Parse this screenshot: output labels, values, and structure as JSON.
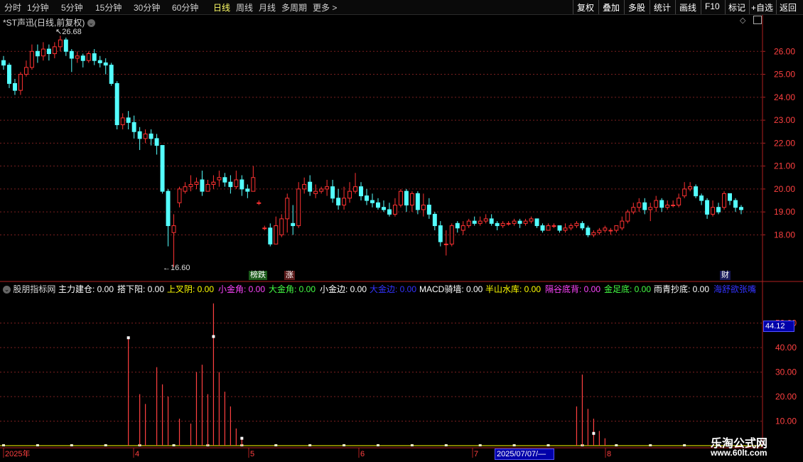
{
  "toolbar": {
    "tabs": [
      "分时",
      "1分钟",
      "5分钟",
      "15分钟",
      "30分钟",
      "60分钟",
      "日线",
      "周线",
      "月线",
      "多周期",
      "更多 >"
    ],
    "active_tab": "日线",
    "tools": [
      "复权",
      "叠加",
      "多股",
      "统计",
      "画线",
      "F10",
      "标记",
      "+自选",
      "返回"
    ]
  },
  "main_chart": {
    "title": "*ST声迅(日线,前复权)",
    "high_label": "26.68",
    "low_label": "16.60",
    "badges": [
      "榜跌",
      "涨",
      "财"
    ]
  },
  "indicator": {
    "title": "股朋指标网",
    "items": [
      {
        "label": "主力建仓: 0.00",
        "color": "#ffffff"
      },
      {
        "label": "搭下阳: 0.00",
        "color": "#ffffff"
      },
      {
        "label": "上叉阴: 0.00",
        "color": "#ffff00"
      },
      {
        "label": "小金角: 0.00",
        "color": "#ff44ff"
      },
      {
        "label": "大金角: 0.00",
        "color": "#44ff44"
      },
      {
        "label": "小金边: 0.00",
        "color": "#ffffff"
      },
      {
        "label": "大金边: 0.00",
        "color": "#3333ff"
      },
      {
        "label": "MACD骑墙: 0.00",
        "color": "#ffffff"
      },
      {
        "label": "半山水库: 0.00",
        "color": "#ffff00"
      },
      {
        "label": "隔谷底背: 0.00",
        "color": "#ff44ff"
      },
      {
        "label": "金足底: 0.00",
        "color": "#44ff44"
      },
      {
        "label": "雨青抄底: 0.00",
        "color": "#ffffff"
      },
      {
        "label": "海舒欲张嘴",
        "color": "#3333ff"
      }
    ],
    "level_value": "44.12"
  },
  "axes": {
    "price_ticks": [
      "26.00",
      "25.00",
      "24.00",
      "23.00",
      "22.00",
      "21.00",
      "20.00",
      "19.00",
      "18.00"
    ],
    "indicator_ticks": [
      "50.00",
      "40.00",
      "30.00",
      "20.00",
      "10.00"
    ],
    "date_labels": [
      "2025年",
      "4",
      "5",
      "6",
      "7",
      "8"
    ],
    "cursor_date": "2025/07/07/—"
  },
  "watermark": {
    "line1": "乐淘公式网",
    "line2": "www.60lt.com"
  },
  "colors": {
    "up": "#ff3232",
    "down": "#54ffff",
    "grid": "#7a1f1f",
    "axis": "#b02020"
  },
  "chart_data": {
    "type": "candlestick",
    "price_range": [
      16.0,
      27.0
    ],
    "candles": [
      [
        25.6,
        25.4,
        25.8,
        25.2
      ],
      [
        25.4,
        24.6,
        25.5,
        24.4
      ],
      [
        24.6,
        24.3,
        24.8,
        24.1
      ],
      [
        24.3,
        25.0,
        25.1,
        24.1
      ],
      [
        25.0,
        25.3,
        25.6,
        24.9
      ],
      [
        25.3,
        26.0,
        26.3,
        25.2
      ],
      [
        26.0,
        25.8,
        26.3,
        25.5
      ],
      [
        25.8,
        26.1,
        26.4,
        25.6
      ],
      [
        26.1,
        25.9,
        26.3,
        25.6
      ],
      [
        25.9,
        26.2,
        26.4,
        25.7
      ],
      [
        26.2,
        26.5,
        26.68,
        26.0
      ],
      [
        26.5,
        26.0,
        26.6,
        25.8
      ],
      [
        26.0,
        25.7,
        26.1,
        25.1
      ],
      [
        25.7,
        25.8,
        26.0,
        25.5
      ],
      [
        25.8,
        25.6,
        25.9,
        25.3
      ],
      [
        25.6,
        25.9,
        26.0,
        25.5
      ],
      [
        25.9,
        25.6,
        26.1,
        25.4
      ],
      [
        25.6,
        25.5,
        25.8,
        25.3
      ],
      [
        25.5,
        25.4,
        25.7,
        25.0
      ],
      [
        25.4,
        24.6,
        25.5,
        24.5
      ],
      [
        24.6,
        22.8,
        24.7,
        22.6
      ],
      [
        22.8,
        23.1,
        23.3,
        22.6
      ],
      [
        23.1,
        22.9,
        23.4,
        22.6
      ],
      [
        22.9,
        22.5,
        23.2,
        22.2
      ],
      [
        22.5,
        22.2,
        22.7,
        21.7
      ],
      [
        22.2,
        22.4,
        22.6,
        22.0
      ],
      [
        22.4,
        22.2,
        22.6,
        21.9
      ],
      [
        22.2,
        21.9,
        22.4,
        21.5
      ],
      [
        21.9,
        19.9,
        21.9,
        19.8
      ],
      [
        19.9,
        18.4,
        20.0,
        17.5
      ],
      [
        18.1,
        18.4,
        18.9,
        16.6
      ],
      [
        19.4,
        20.0,
        20.1,
        19.2
      ],
      [
        19.9,
        20.1,
        20.3,
        19.8
      ],
      [
        20.1,
        20.2,
        20.6,
        19.9
      ],
      [
        20.2,
        20.3,
        20.5,
        20.0
      ],
      [
        20.4,
        19.9,
        20.8,
        19.7
      ],
      [
        19.9,
        20.2,
        20.4,
        19.9
      ],
      [
        20.2,
        20.3,
        20.6,
        20.0
      ],
      [
        20.4,
        20.5,
        20.8,
        20.1
      ],
      [
        20.5,
        20.3,
        20.7,
        20.1
      ],
      [
        20.3,
        20.1,
        20.6,
        19.8
      ],
      [
        20.1,
        20.4,
        20.8,
        20.0
      ],
      [
        20.4,
        20.0,
        20.6,
        19.7
      ],
      [
        20.0,
        19.9,
        20.2,
        19.6
      ],
      [
        19.9,
        20.5,
        21.0,
        19.9
      ],
      [
        19.4,
        19.4,
        19.5,
        19.3
      ],
      [
        18.3,
        18.3,
        18.4,
        18.2
      ],
      [
        18.3,
        17.6,
        18.5,
        17.5
      ],
      [
        17.6,
        18.4,
        18.8,
        17.6
      ],
      [
        18.0,
        18.7,
        18.9,
        17.9
      ],
      [
        18.7,
        19.6,
        19.8,
        18.1
      ],
      [
        18.5,
        18.4,
        19.3,
        18.0
      ],
      [
        18.4,
        20.0,
        20.3,
        18.3
      ],
      [
        20.0,
        20.2,
        20.5,
        19.8
      ],
      [
        20.3,
        19.9,
        20.6,
        19.7
      ],
      [
        19.8,
        19.9,
        20.2,
        19.6
      ],
      [
        19.9,
        20.0,
        20.1,
        19.8
      ],
      [
        20.0,
        20.1,
        20.4,
        19.7
      ],
      [
        20.1,
        19.6,
        20.4,
        19.4
      ],
      [
        19.6,
        19.3,
        20.0,
        19.1
      ],
      [
        19.3,
        19.6,
        20.1,
        19.1
      ],
      [
        19.6,
        19.9,
        20.3,
        19.4
      ],
      [
        19.9,
        20.1,
        20.7,
        19.8
      ],
      [
        20.1,
        19.7,
        20.3,
        19.5
      ],
      [
        19.7,
        19.5,
        20.0,
        19.3
      ],
      [
        19.5,
        19.4,
        19.8,
        19.2
      ],
      [
        19.4,
        19.2,
        19.6,
        19.1
      ],
      [
        19.2,
        19.1,
        19.5,
        19.0
      ],
      [
        19.1,
        18.9,
        19.4,
        18.8
      ],
      [
        18.9,
        19.3,
        19.6,
        18.8
      ],
      [
        19.3,
        19.9,
        20.0,
        19.2
      ],
      [
        19.9,
        19.3,
        20.0,
        19.0
      ],
      [
        19.3,
        19.8,
        19.9,
        19.0
      ],
      [
        19.8,
        19.1,
        19.9,
        18.9
      ],
      [
        19.1,
        19.3,
        19.8,
        18.8
      ],
      [
        19.3,
        18.9,
        19.6,
        18.7
      ],
      [
        18.9,
        18.4,
        19.0,
        18.2
      ],
      [
        18.4,
        17.7,
        18.6,
        17.5
      ],
      [
        17.6,
        17.6,
        18.2,
        17.1
      ],
      [
        17.6,
        18.4,
        18.5,
        17.5
      ],
      [
        18.5,
        18.3,
        18.6,
        18.1
      ],
      [
        18.2,
        18.4,
        18.6,
        18.0
      ],
      [
        18.4,
        18.6,
        18.7,
        18.3
      ],
      [
        18.6,
        18.5,
        18.8,
        18.4
      ],
      [
        18.5,
        18.6,
        18.8,
        18.4
      ],
      [
        18.6,
        18.7,
        18.9,
        18.5
      ],
      [
        18.7,
        18.5,
        18.9,
        18.4
      ],
      [
        18.5,
        18.4,
        18.6,
        18.2
      ],
      [
        18.4,
        18.5,
        18.6,
        18.3
      ],
      [
        18.5,
        18.5,
        18.6,
        18.4
      ],
      [
        18.5,
        18.6,
        18.7,
        18.4
      ],
      [
        18.6,
        18.5,
        18.7,
        18.3
      ],
      [
        18.5,
        18.6,
        18.7,
        18.4
      ],
      [
        18.6,
        18.7,
        18.8,
        18.5
      ],
      [
        18.7,
        18.4,
        18.7,
        18.3
      ],
      [
        18.4,
        18.2,
        18.5,
        18.1
      ],
      [
        18.2,
        18.4,
        18.5,
        18.2
      ],
      [
        18.4,
        18.4,
        18.5,
        18.3
      ],
      [
        18.4,
        18.2,
        18.4,
        18.1
      ],
      [
        18.2,
        18.3,
        18.5,
        18.1
      ],
      [
        18.3,
        18.4,
        18.5,
        18.2
      ],
      [
        18.4,
        18.5,
        18.6,
        18.3
      ],
      [
        18.5,
        18.3,
        18.6,
        18.2
      ],
      [
        18.3,
        18.0,
        18.4,
        17.9
      ],
      [
        18.0,
        18.1,
        18.2,
        17.9
      ],
      [
        18.1,
        18.2,
        18.3,
        18.0
      ],
      [
        18.2,
        18.3,
        18.4,
        18.1
      ],
      [
        18.2,
        18.2,
        18.3,
        18.0
      ],
      [
        18.2,
        18.4,
        18.4,
        18.1
      ],
      [
        18.3,
        18.6,
        18.8,
        18.2
      ],
      [
        18.6,
        19.0,
        19.1,
        18.5
      ],
      [
        19.0,
        19.2,
        19.4,
        18.9
      ],
      [
        19.2,
        19.4,
        19.6,
        19.0
      ],
      [
        19.4,
        19.1,
        19.6,
        18.9
      ],
      [
        19.1,
        19.2,
        19.4,
        18.6
      ],
      [
        19.2,
        19.5,
        19.7,
        19.0
      ],
      [
        19.5,
        19.2,
        19.6,
        19.0
      ],
      [
        19.2,
        19.3,
        19.5,
        19.1
      ],
      [
        19.3,
        19.3,
        19.5,
        19.2
      ],
      [
        19.3,
        19.6,
        19.8,
        19.2
      ],
      [
        19.7,
        20.0,
        20.3,
        19.6
      ],
      [
        20.0,
        20.1,
        20.3,
        19.9
      ],
      [
        20.1,
        19.7,
        20.2,
        19.6
      ],
      [
        19.7,
        19.5,
        19.8,
        19.3
      ],
      [
        19.5,
        18.9,
        19.6,
        18.7
      ],
      [
        18.9,
        19.2,
        19.5,
        18.8
      ],
      [
        19.2,
        19.0,
        19.4,
        18.9
      ],
      [
        19.2,
        19.8,
        19.9,
        19.1
      ],
      [
        19.8,
        19.5,
        19.8,
        19.3
      ],
      [
        19.5,
        19.2,
        19.6,
        19.0
      ],
      [
        19.2,
        19.1,
        19.3,
        18.9
      ]
    ],
    "indicator_bars": [
      {
        "i": 22,
        "v": 44
      },
      {
        "i": 24,
        "v": 21
      },
      {
        "i": 25,
        "v": 17
      },
      {
        "i": 27,
        "v": 32
      },
      {
        "i": 28,
        "v": 25
      },
      {
        "i": 29,
        "v": 20
      },
      {
        "i": 31,
        "v": 11
      },
      {
        "i": 33,
        "v": 9
      },
      {
        "i": 34,
        "v": 30
      },
      {
        "i": 35,
        "v": 33
      },
      {
        "i": 36,
        "v": 21
      },
      {
        "i": 37,
        "v": 58
      },
      {
        "i": 38,
        "v": 30
      },
      {
        "i": 39,
        "v": 22
      },
      {
        "i": 40,
        "v": 16
      },
      {
        "i": 41,
        "v": 7
      },
      {
        "i": 42,
        "v": 3
      },
      {
        "i": 101,
        "v": 16
      },
      {
        "i": 102,
        "v": 29
      },
      {
        "i": 103,
        "v": 15
      },
      {
        "i": 104,
        "v": 11
      },
      {
        "i": 105,
        "v": 6
      },
      {
        "i": 106,
        "v": 3
      }
    ],
    "indicator_range": [
      0,
      60
    ]
  }
}
